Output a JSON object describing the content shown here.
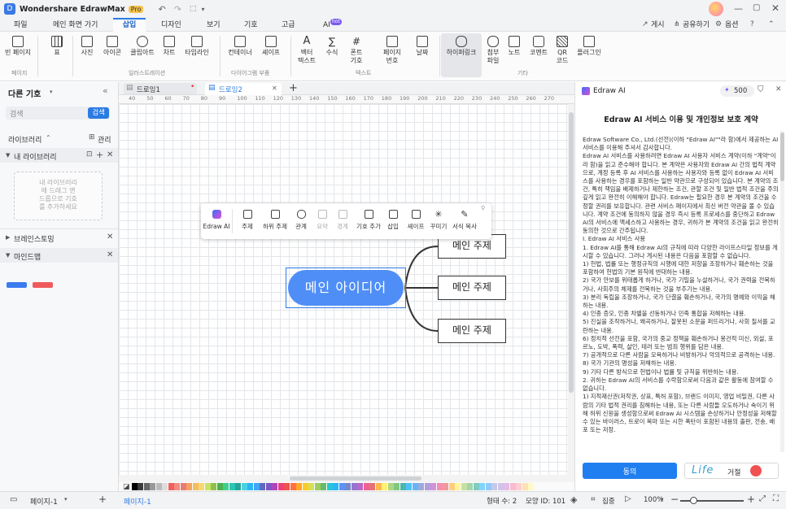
{
  "app": {
    "title": "Wondershare EdrawMax",
    "badge": "Pro"
  },
  "menu": {
    "items": [
      "파일",
      "메인 화면 가기",
      "삽입",
      "디자인",
      "보기",
      "기호",
      "고급",
      "AI"
    ],
    "ai_badge": "hot",
    "right": [
      "게시",
      "공유하기",
      "옵션"
    ]
  },
  "ribbon": {
    "buttons": [
      "빈 페이지",
      "표",
      "사진",
      "아이콘",
      "클립아트",
      "차트",
      "타임라인",
      "컨테이너",
      "셰이프",
      "벡터\n텍스트",
      "수식",
      "폰트\n기호",
      "페이지\n번호",
      "날짜",
      "하이퍼링크",
      "첨부\n파일",
      "노트",
      "코멘트",
      "QR\n코드",
      "플러그인"
    ],
    "groups": [
      "페이지",
      "",
      "일러스트레이션",
      "다이어그램 부품",
      "텍스트",
      "기타"
    ]
  },
  "left": {
    "title": "다른 기호",
    "search_placeholder": "검색",
    "search_button": "검색",
    "library_label": "라이브러리",
    "manage_label": "관리",
    "my_library": "내 라이브러리",
    "empty_hint": "내 라이브러리\n에 드래그 앤\n드롭으로 기호\n를 추가하세요",
    "brainstorm": "브레인스토밍",
    "mindmap": "마인드맵"
  },
  "tabs": [
    "드로잉1",
    "드로잉2"
  ],
  "ruler": [
    "40",
    "50",
    "60",
    "70",
    "80",
    "90",
    "100",
    "110",
    "120",
    "130",
    "140",
    "150",
    "160",
    "170",
    "180",
    "190",
    "200",
    "210",
    "220",
    "230",
    "240",
    "250",
    "260",
    "270"
  ],
  "floating_toolbar": [
    "Edraw AI",
    "주제",
    "하위 주제",
    "관계",
    "요약",
    "경계",
    "기호 추가",
    "삽입",
    "셰이프",
    "꾸미기",
    "서식 복사"
  ],
  "mindmap": {
    "main": "메인 아이디어",
    "topics": [
      "메인 주제",
      "메인 주제",
      "메인 주제"
    ]
  },
  "ai_panel": {
    "title": "Edraw AI",
    "credits": "500",
    "heading": "Edraw AI 서비스 이용 및 개인정보 보호 계약",
    "body": "Edraw Software Co., Ltd.(선전)(이하 \"Edraw AI\"\"라 함)에서 제공하는 AI 서비스를 이용해 주셔서 감사합니다.\nEdraw AI 서비스를 사용하려면 Edraw AI 사용자 서비스 계약(이하 \"계약\"이라 함)을 읽고 준수해야 합니다. 본 계약은 사용자와 Edraw AI 간의 법적 계약으로, 계정 등록 후 AI 서비스를 사용하는 사용자와 등록 없이 Edraw AI 서비스를 사용하는 경우를 포함하는 일반 약관으로 구성되어 있습니다. 본 계약의 조건, 특히 책임을 배제하거나 제한하는 조건, 관할 조건 및 일반 법적 조건을 주의 깊게 읽고 완전히 이해해야 합니다. Edraw는 필요한 경우 본 계약의 조건을 수정할 권리를 보유합니다. 관련 서비스 페이지에서 최신 버전 약관을 볼 수 있습니다. 계약 조건에 동의하지 않을 경우 즉시 등록 프로세스를 중단하고 Edraw AI의 서비스에 액세스하고 사용하는 경우, 귀하가 본 계약의 조건을 읽고 완전히 동의한 것으로 간주됩니다.\nI. Edraw AI 서비스 사용\n1. Edraw AI를 통해 Edraw AI의 규칙에 따라 다양한 라이프스타일 정보를 게시할 수 있습니다. 그러나 게시된 내용은 다음을 포함할 수 없습니다.\n1) 헌법, 법률 또는 행정규칙의 시행에 대한 저항을 조장하거나 훼손하는 것을 포함하여 헌법의 기본 원칙에 반대하는 내용.\n2) 국가 안보를 위태롭게 하거나, 국가 기밀을 누설하거나, 국가 권력을 전복하거나, 사회주의 체제를 전복하는 것을 부추기는 내용.\n3) 분리 독립을 조장하거나, 국가 단결을 훼손하거나, 국가의 명예와 이익을 해하는 내용.\n4) 인종 증오, 인종 차별을 선동하거나 민족 통합을 저해하는 내용.\n5) 진실을 조작하거나, 왜곡하거나, 잘못된 소문을 퍼뜨리거나, 사회 질서를 교란하는 내용.\n6) 정치적 선전을 포함, 국가의 중교 정책을 훼손하거나 봉건적 미신, 외설, 포르노, 도박, 폭력, 살인, 테러 또는 범죄 행위를 담은 내용.\n7) 공개적으로 다른 사람을 모욕하거나 비방하거나 악의적으로 공격하는 내용.\n8) 국가 기관의 명성을 저해하는 내용.\n9) 기타 다른 방식으로 헌법이나 법률 및 규칙을 위반하는 내용.\n2. 귀하는 Edraw AI의 서비스를 수락함으로써 다음과 같은 활동에 참여할 수 없습니다.\n1) 지적재산권(저작권, 상표, 특허 포함), 브랜드 이미지, 영업 비밀권, 다른 사람의 기타 법적 권리를 침해하는 내용, 또는 다른 사람들 오도하거나 속이기 위해 허위 신원을 생성함으로써 Edraw AI 시스템을 손상하거나 안정성을 저해할 수 있는 바이러스, 트로이 목마 또는 시한 폭탄이 포함된 내용의 출판, 전송, 배포 또는 저장.",
    "agree": "동의",
    "reject": "거절",
    "watermark": "Life"
  },
  "status": {
    "page_select": "페이지-1",
    "page_tab": "페이지-1",
    "shapes": "형태 수: 2",
    "shape_id": "모양 ID: 101",
    "focus": "집중",
    "zoom": "100%"
  },
  "colors": {
    "accent": "#2b7be4",
    "node_fill": "#4f8ef7"
  }
}
